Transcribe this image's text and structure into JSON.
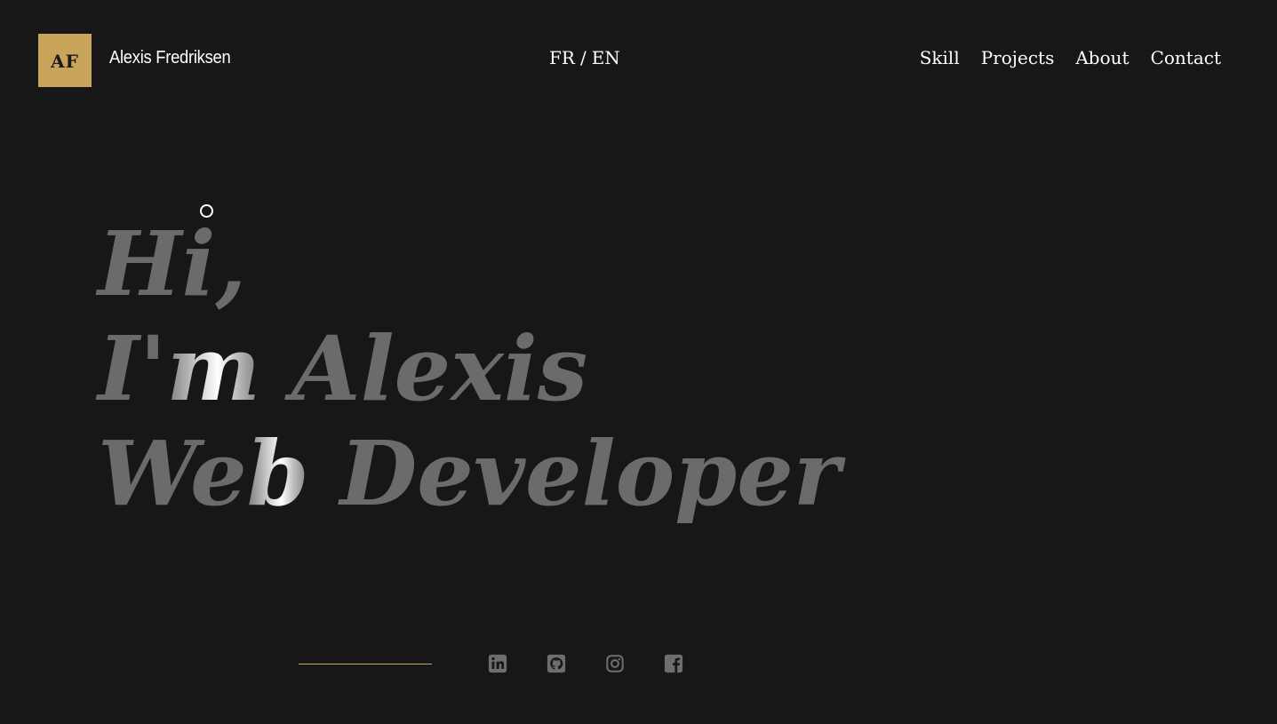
{
  "brand": {
    "logo_text": "AF",
    "name": "Alexis Fredriksen"
  },
  "lang": {
    "fr": "FR",
    "separator": "/",
    "en": "EN"
  },
  "nav": {
    "items": [
      "Skill",
      "Projects",
      "About",
      "Contact"
    ]
  },
  "hero": {
    "line1": "Hi,",
    "line2_a": "I'",
    "line2_b": "m",
    "line2_c": " Alexis",
    "line3_a": "We",
    "line3_b": "b",
    "line3_c": " Developer"
  },
  "socials": [
    "linkedin-icon",
    "github-icon",
    "instagram-icon",
    "facebook-icon"
  ],
  "colors": {
    "background": "#171717",
    "accent": "#c8a55a",
    "hero_text": "#6b6b6b",
    "icon": "#6e6e6e"
  }
}
